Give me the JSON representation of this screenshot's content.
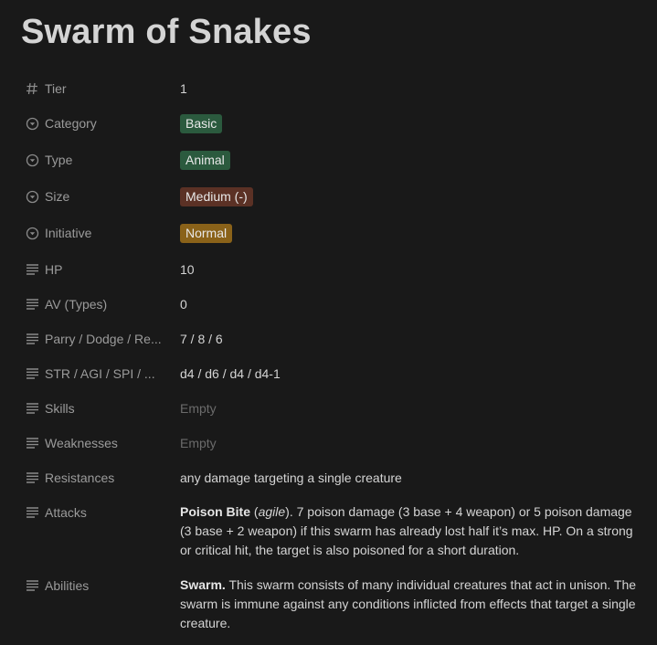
{
  "title": "Swarm of Snakes",
  "properties": {
    "tier": {
      "label": "Tier",
      "value": "1"
    },
    "category": {
      "label": "Category",
      "value": "Basic"
    },
    "type": {
      "label": "Type",
      "value": "Animal"
    },
    "size": {
      "label": "Size",
      "value": "Medium (-)"
    },
    "initiative": {
      "label": "Initiative",
      "value": "Normal"
    },
    "hp": {
      "label": "HP",
      "value": "10"
    },
    "av": {
      "label": "AV (Types)",
      "value": "0"
    },
    "parry": {
      "label": "Parry / Dodge / Re...",
      "value": "7 / 8 / 6"
    },
    "stats": {
      "label": "STR / AGI / SPI / ...",
      "value": "d4 / d6 / d4 / d4-1"
    },
    "skills": {
      "label": "Skills",
      "value": "Empty"
    },
    "weaknesses": {
      "label": "Weaknesses",
      "value": "Empty"
    },
    "resistances": {
      "label": "Resistances",
      "value": "any damage targeting a single creature"
    },
    "attacks": {
      "label": "Attacks",
      "name": "Poison Bite",
      "open": " (",
      "trait": "agile",
      "desc": "). 7 poison damage (3 base + 4 weapon) or 5 poison damage (3 base + 2 weapon) if this swarm has already lost half it’s max. HP. On a strong or critical hit, the target is also poisoned for a short duration."
    },
    "abilities": {
      "label": "Abilities",
      "name": "Swarm.",
      "desc": " This swarm consists of many individual creatures that act in unison. The swarm is immune against any conditions inflicted from effects that target a single creature."
    }
  },
  "colors": {
    "background": "#191919",
    "tag_green": "#2b5a3e",
    "tag_brown": "#5b3125",
    "tag_yellow": "#8a6219"
  },
  "icons": {
    "number": "hash-icon",
    "select": "select-circle-icon",
    "text": "text-lines-icon"
  }
}
